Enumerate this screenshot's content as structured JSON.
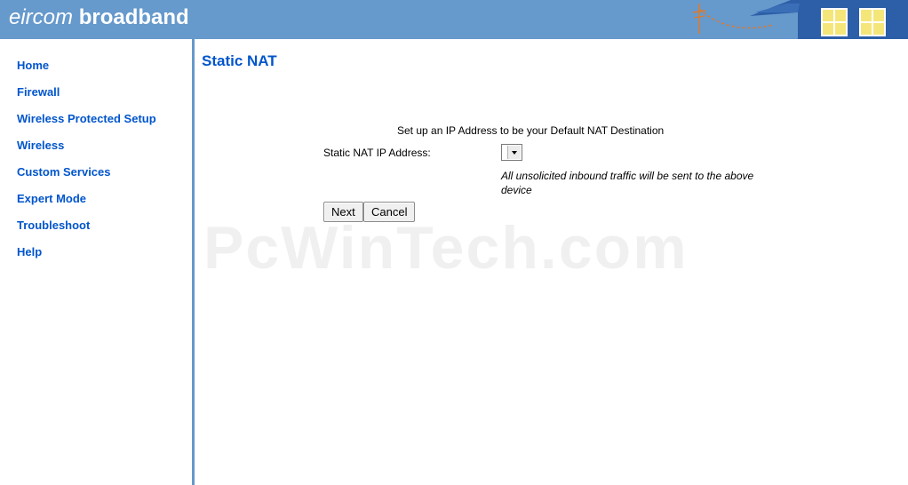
{
  "header": {
    "brand_light": "eircom",
    "brand_bold": "broadband"
  },
  "sidebar": {
    "items": [
      {
        "label": "Home",
        "id": "home"
      },
      {
        "label": "Firewall",
        "id": "firewall"
      },
      {
        "label": "Wireless Protected Setup",
        "id": "wireless-protected-setup"
      },
      {
        "label": "Wireless",
        "id": "wireless"
      },
      {
        "label": "Custom Services",
        "id": "custom-services"
      },
      {
        "label": "Expert Mode",
        "id": "expert-mode"
      },
      {
        "label": "Troubleshoot",
        "id": "troubleshoot"
      },
      {
        "label": "Help",
        "id": "help"
      }
    ]
  },
  "main": {
    "title": "Static NAT",
    "intro": "Set up an IP Address to be your Default NAT Destination",
    "field_label": "Static NAT IP Address:",
    "select_value": "",
    "hint": "All unsolicited inbound traffic will be sent to the above device",
    "next_label": "Next",
    "cancel_label": "Cancel"
  },
  "watermark": "PcWinTech.com",
  "colors": {
    "header_bg": "#6699cc",
    "link": "#0055cc",
    "window_yellow": "#f5e67a"
  },
  "icons": {
    "decor": "house-windows-illustration",
    "select": "chevron-down-icon"
  }
}
